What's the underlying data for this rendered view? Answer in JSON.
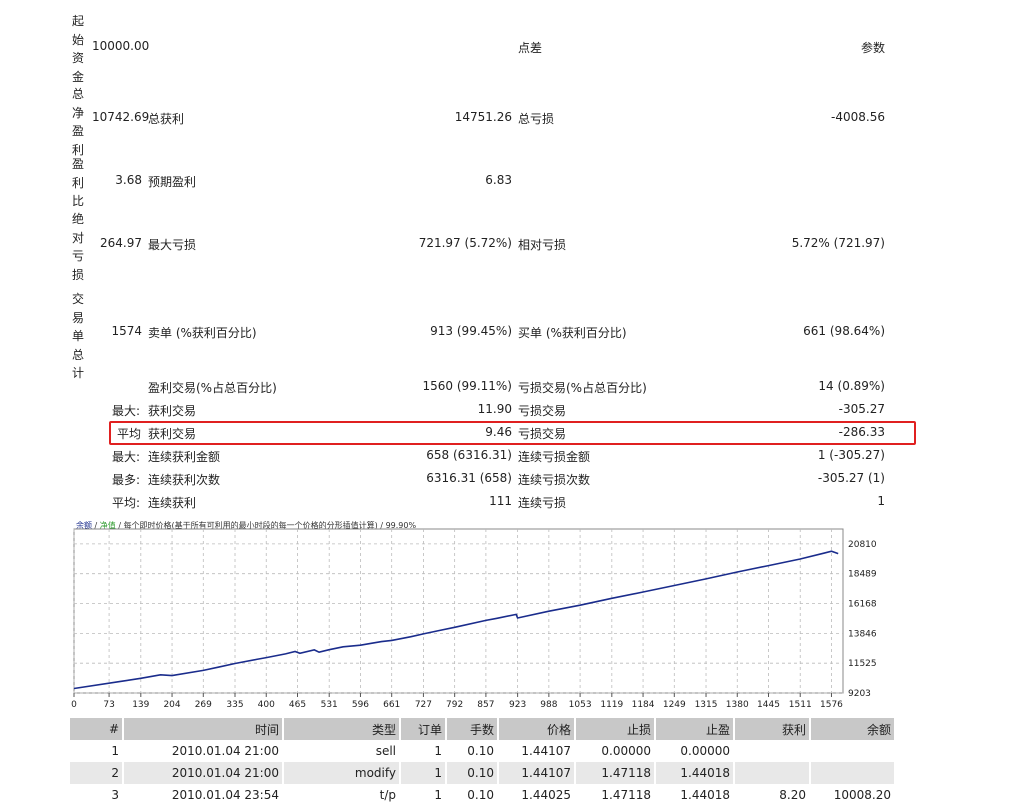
{
  "summary": {
    "initial_label": "起始资金",
    "initial_value": "10000.00",
    "spread_label": "点差",
    "params_label": "参数",
    "net_label": "总净盈利",
    "net_value": "10742.69",
    "gross_profit_label": "总获利",
    "gross_profit_value": "14751.26",
    "gross_loss_label": "总亏损",
    "gross_loss_value": "-4008.56",
    "pf_label": "盈利比",
    "pf_value": "3.68",
    "expected_label": "预期盈利",
    "expected_value": "6.83",
    "abs_dd_label": "绝对亏损",
    "abs_dd_value": "264.97",
    "max_dd_label": "最大亏损",
    "max_dd_value": "721.97 (5.72%)",
    "rel_dd_label": "相对亏损",
    "rel_dd_value": "5.72% (721.97)",
    "trades_label": "交易单总计",
    "trades_value": "1574",
    "short_label": "卖单 (%获利百分比)",
    "short_value": "913 (99.45%)",
    "long_label": "买单 (%获利百分比)",
    "long_value": "661 (98.64%)"
  },
  "stats_rows": [
    {
      "prefix": "",
      "l1": "盈利交易(%占总百分比)",
      "v1": "1560 (99.11%)",
      "l2": "亏损交易(%占总百分比)",
      "v2": "14 (0.89%)"
    },
    {
      "prefix": "最大:",
      "l1": "获利交易",
      "v1": "11.90",
      "l2": "亏损交易",
      "v2": "-305.27"
    },
    {
      "prefix": "平均",
      "l1": "获利交易",
      "v1": "9.46",
      "l2": "亏损交易",
      "v2": "-286.33"
    },
    {
      "prefix": "最大:",
      "l1": "连续获利金额",
      "v1": "658 (6316.31)",
      "l2": "连续亏损金额",
      "v2": "1 (-305.27)"
    },
    {
      "prefix": "最多:",
      "l1": "连续获利次数",
      "v1": "6316.31 (658)",
      "l2": "连续亏损次数",
      "v2": "-305.27 (1)"
    },
    {
      "prefix": "平均:",
      "l1": "连续获利",
      "v1": "111",
      "l2": "连续亏损",
      "v2": "1"
    }
  ],
  "chart_header": {
    "balance_label": "余额",
    "equity_label": "净值",
    "description": " / 每个即时价格(基于所有可利用的最小时段的每一个价格的分形插值计算) / 99.90%",
    "balance_color": "#1a2c8c",
    "equity_color": "#2a9a2a"
  },
  "chart_data": {
    "type": "line",
    "series": [
      {
        "name": "余额",
        "color": "#1a2c8c",
        "x": [
          0,
          100,
          139,
          180,
          204,
          269,
          300,
          335,
          380,
          400,
          440,
          460,
          470,
          500,
          510,
          531,
          560,
          596,
          620,
          640,
          661,
          700,
          727,
          760,
          792,
          857,
          880,
          920,
          923,
          988,
          1053,
          1119,
          1184,
          1249,
          1315,
          1380,
          1445,
          1511,
          1560,
          1576,
          1590
        ],
        "y": [
          9550,
          10120,
          10350,
          10620,
          10560,
          10960,
          11210,
          11500,
          11820,
          11960,
          12250,
          12430,
          12290,
          12560,
          12380,
          12570,
          12800,
          12920,
          13080,
          13200,
          13300,
          13580,
          13800,
          14070,
          14320,
          14850,
          15020,
          15320,
          15040,
          15570,
          16040,
          16570,
          17060,
          17570,
          18080,
          18620,
          19120,
          19630,
          20080,
          20240,
          20050
        ]
      }
    ],
    "x_ticks": [
      0,
      73,
      139,
      204,
      269,
      335,
      400,
      465,
      531,
      596,
      661,
      727,
      792,
      857,
      923,
      988,
      1053,
      1119,
      1184,
      1249,
      1315,
      1380,
      1445,
      1511,
      1576
    ],
    "y_ticks": [
      9203,
      11525,
      13846,
      16168,
      18489,
      20810
    ],
    "xlim": [
      0,
      1600
    ],
    "ylim": [
      9203,
      21500
    ],
    "grid": true
  },
  "trades_table": {
    "headers": [
      "#",
      "时间",
      "类型",
      "订单",
      "手数",
      "价格",
      "止损",
      "止盈",
      "获利",
      "余额"
    ],
    "rows": [
      [
        "1",
        "2010.01.04 21:00",
        "sell",
        "1",
        "0.10",
        "1.44107",
        "0.00000",
        "0.00000",
        "",
        ""
      ],
      [
        "2",
        "2010.01.04 21:00",
        "modify",
        "1",
        "0.10",
        "1.44107",
        "1.47118",
        "1.44018",
        "",
        ""
      ],
      [
        "3",
        "2010.01.04 23:54",
        "t/p",
        "1",
        "0.10",
        "1.44025",
        "1.47118",
        "1.44018",
        "8.20",
        "10008.20"
      ]
    ]
  }
}
